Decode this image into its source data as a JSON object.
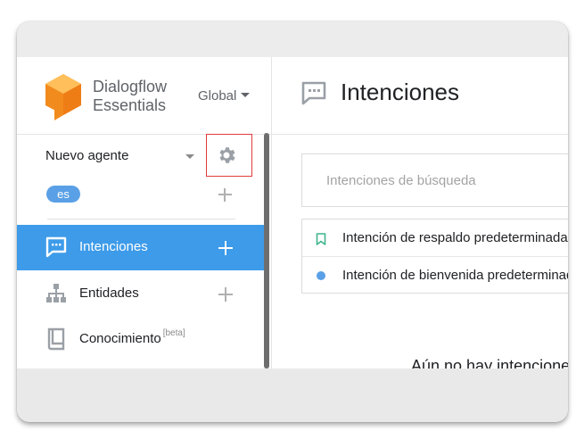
{
  "brand": {
    "name": "Dialogflow Essentials",
    "scope_label": "Global"
  },
  "agent": {
    "name": "Nuevo agente",
    "language": "es"
  },
  "sidebar": {
    "items": [
      {
        "label": "Intenciones",
        "icon": "chat-icon",
        "active": true
      },
      {
        "label": "Entidades",
        "icon": "hierarchy-icon",
        "active": false
      },
      {
        "label": "Conocimiento",
        "badge": "[beta]",
        "icon": "book-icon",
        "active": false
      }
    ]
  },
  "main": {
    "title": "Intenciones",
    "search_placeholder": "Intenciones de búsqueda",
    "intents": [
      {
        "name": "Intención de respaldo predeterminada",
        "icon": "bookmark-icon"
      },
      {
        "name": "Intención de bienvenida predeterminada",
        "icon": "dot-icon"
      }
    ],
    "empty_message": "Aún no hay intenciones"
  },
  "colors": {
    "accent": "#3d9be9",
    "chip": "#5aa0e6",
    "logo_orange": "#f28b1e",
    "highlight_border": "#e03c3c"
  }
}
